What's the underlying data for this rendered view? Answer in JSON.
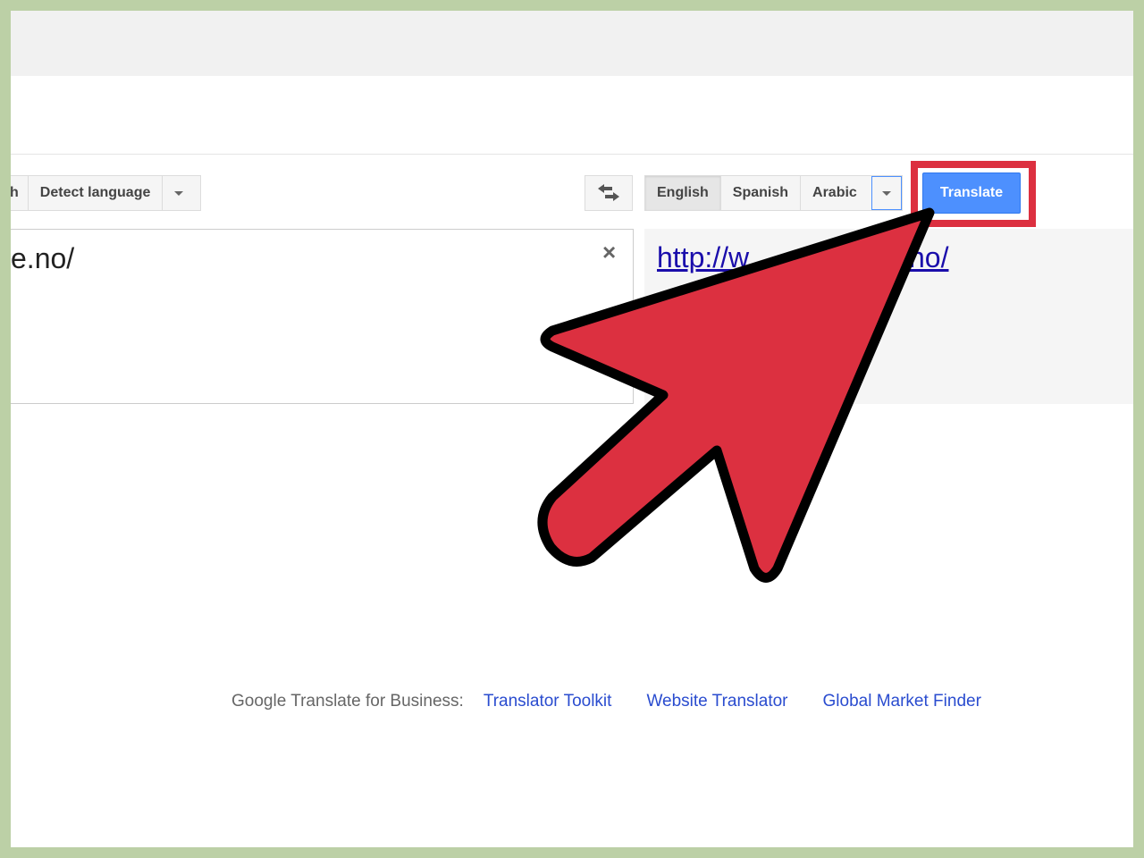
{
  "source_langs": {
    "partial_label": "h",
    "detect": "Detect language"
  },
  "source_text": "e.no/",
  "clear_glyph": "×",
  "swap_icon": "swap-arrows-icon",
  "target_langs": [
    "English",
    "Spanish",
    "Arabic"
  ],
  "translate_label": "Translate",
  "output": {
    "visible_start": "http://w",
    "visible_end": "no/"
  },
  "footer": {
    "label": "Google Translate for Business:",
    "links": [
      "Translator Toolkit",
      "Website Translator",
      "Global Market Finder"
    ]
  },
  "colors": {
    "highlight": "#dc3040",
    "translate_button": "#4d90fe",
    "frame": "#bcd0a6"
  }
}
